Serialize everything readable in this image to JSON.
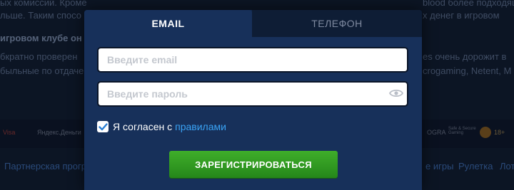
{
  "background": {
    "lines": [
      "ых комиссий. Кроме",
      "льше. Таким спосо",
      "игровом клубе он",
      "бкратно проверен",
      "быльные по отдаче",
      "blood более подходяще",
      "х денег в игровом",
      "es очень дорожит в",
      "crogaming, Netent, M"
    ],
    "logos": [
      "Visa",
      "Яндекс.Деньги",
      "OGRA",
      "Safe & Secure Gaming",
      "18+"
    ],
    "nav": [
      "Партнерская прогр",
      "е игры",
      "Рулетка",
      "Лот"
    ]
  },
  "tabs": [
    {
      "label": "EMAIL",
      "active": true
    },
    {
      "label": "ТЕЛЕФОН",
      "active": false
    }
  ],
  "form": {
    "email_placeholder": "Введите email",
    "email_value": "",
    "password_placeholder": "Введите пароль",
    "password_value": "",
    "eye_icon": "eye-icon",
    "agree_checked": true,
    "agree_text": "Я согласен с",
    "agree_link": "правилами",
    "submit_label": "ЗАРЕГИСТРИРОВАТЬСЯ"
  },
  "colors": {
    "modal_bg": "#17305a",
    "tab_inactive_bg": "#0e1d35",
    "link": "#3aa3f5",
    "submit": "#2f9a22",
    "checkbox_mark": "#2a7fd4"
  }
}
